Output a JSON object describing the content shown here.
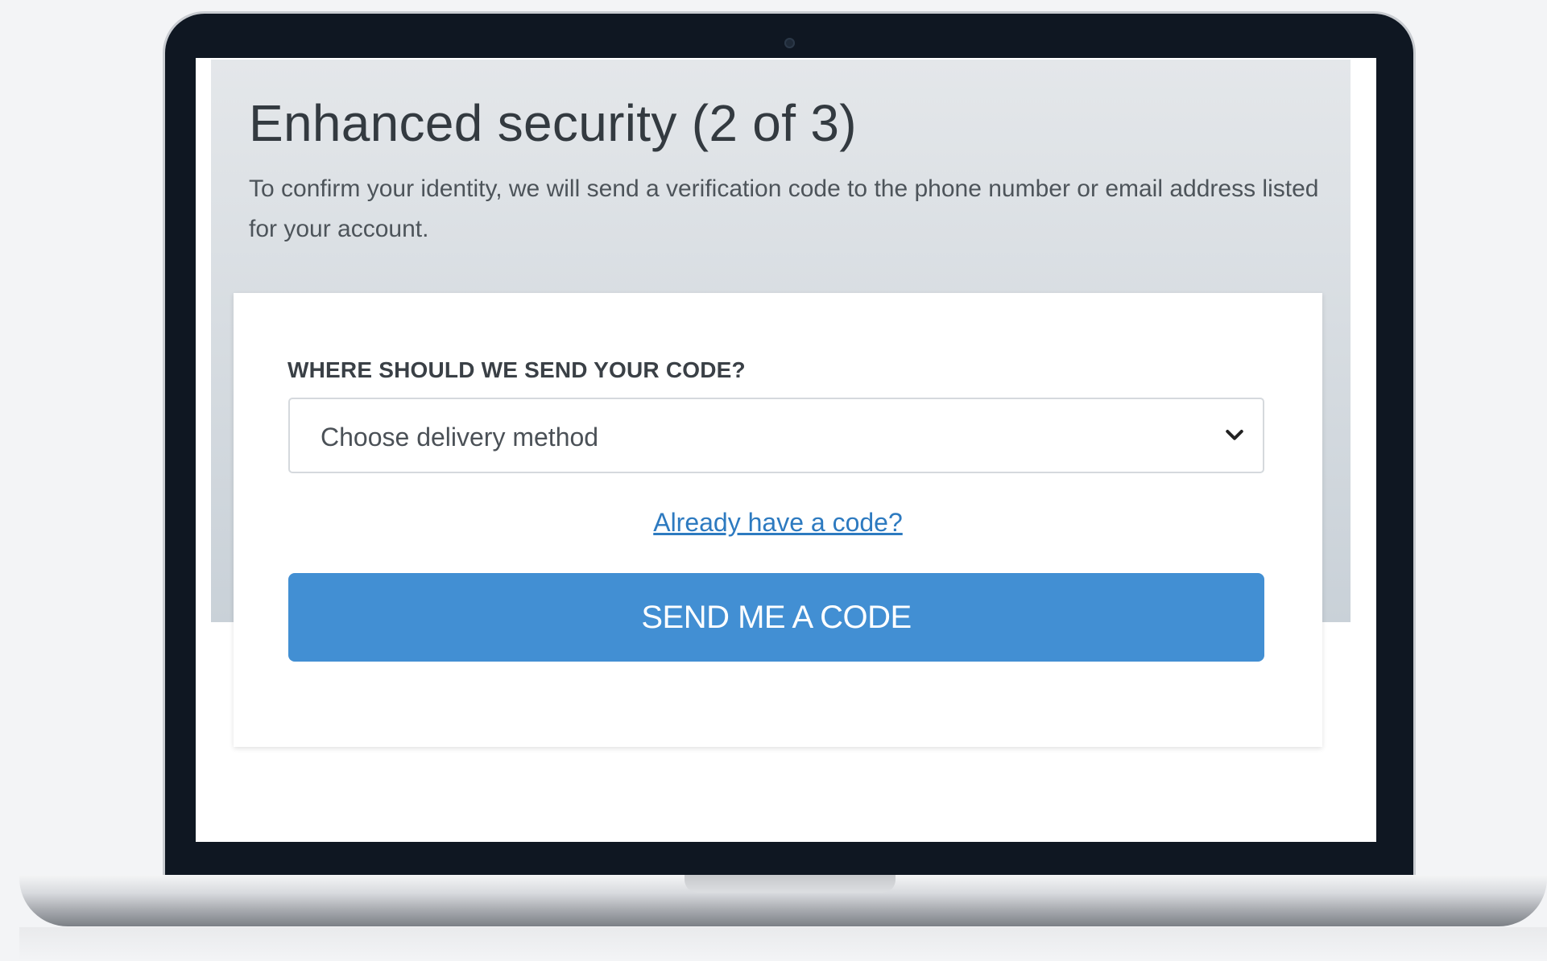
{
  "page": {
    "title": "Enhanced security (2 of 3)",
    "description": "To confirm your identity, we will send a verification code to the phone number or email address listed for your account."
  },
  "form": {
    "field_label": "WHERE SHOULD WE SEND YOUR CODE?",
    "select_value": "Choose delivery method",
    "already_have_code_link": "Already have a code?",
    "submit_label": "SEND ME A CODE"
  },
  "icons": {
    "select_arrow": "chevron-down-icon",
    "webcam": "camera-icon"
  },
  "colors": {
    "primary_button": "#428fd3",
    "link": "#2d7ac0",
    "bezel": "#0f1722"
  }
}
